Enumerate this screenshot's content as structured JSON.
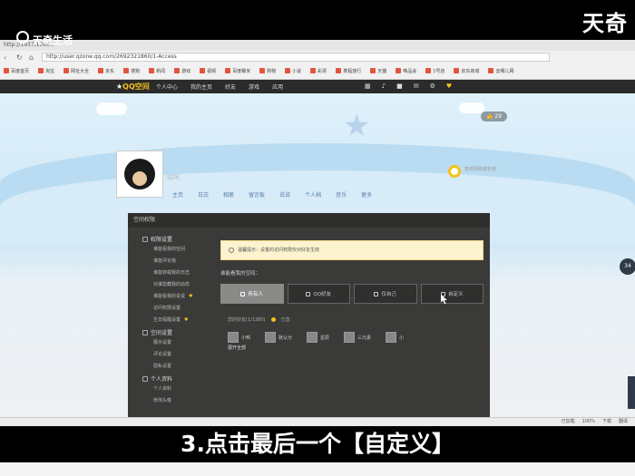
{
  "watermark": {
    "right": "天奇",
    "left": "天奇生活"
  },
  "browser": {
    "tab": "http://1937/1969...",
    "url": "http://user.qzone.qq.com/2692321860/1-Access",
    "bookmarks": [
      "百度首页",
      "淘宝",
      "网址大全",
      "京东",
      "搜狗",
      "新闻",
      "游戏",
      "视频",
      "百度糯米",
      "购物",
      "小说",
      "彩票",
      "携程旅行",
      "天猫",
      "唯品会",
      "1号店",
      "京东商城",
      "去哪儿网"
    ]
  },
  "qqbar": {
    "logo_prefix": "QQ",
    "logo_suffix": "空间",
    "nav": [
      "个人中心",
      "我的主页",
      "好友",
      "游戏",
      "应用"
    ]
  },
  "profile": {
    "nickname": "知呵",
    "tabs": [
      "主页",
      "日志",
      "相册",
      "留言板",
      "说说",
      "个人档",
      "音乐",
      "更多"
    ],
    "likes": "29",
    "sign": "签到领取成长值"
  },
  "panel": {
    "title": "空间权限",
    "side": [
      {
        "group": "权限设置",
        "items": [
          "谁能看我的空间",
          "谁能评论我",
          "谁能转载我的日志",
          "对谁隐藏我的动态",
          "谁能看我的说说",
          "访问权限设置",
          "生日提醒设置"
        ]
      },
      {
        "group": "空间设置",
        "items": [
          "展示设置",
          "评论设置",
          "隐私设置"
        ]
      },
      {
        "group": "个人资料",
        "items": [
          "个人资料",
          "修改头像"
        ]
      }
    ],
    "notice": "温馨提示：设置的访问权限仅对好友生效",
    "label": "谁能看我的空间：",
    "options": [
      "所有人",
      "QQ好友",
      "仅自己",
      "自定义"
    ],
    "friends_head": "您的好友(1/1380)",
    "friends_tag": "已选",
    "friends": [
      "小鸭",
      "默认分",
      "星辰",
      "三元素",
      "小"
    ],
    "friend_sub": "展开全部",
    "save": "保存"
  },
  "right_chip": "34",
  "statusbar": [
    "已加载",
    "100%",
    "下载",
    "翻译"
  ],
  "caption": "3.点击最后一个【自定义】"
}
